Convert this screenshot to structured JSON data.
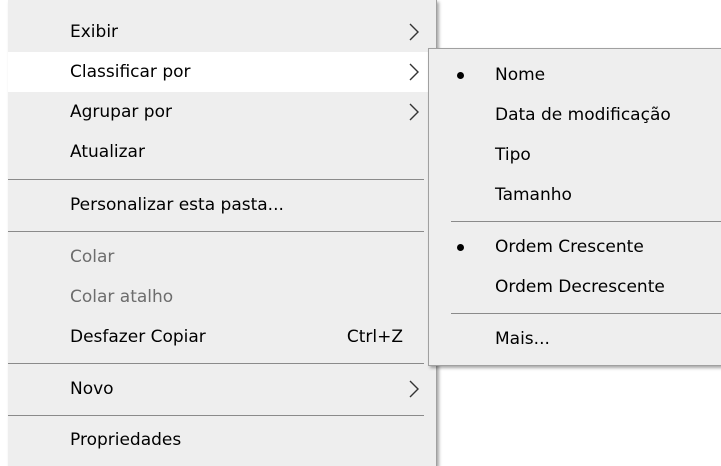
{
  "context_menu": {
    "items": [
      {
        "label": "Exibir",
        "submenu": true
      },
      {
        "label": "Classificar por",
        "submenu": true
      },
      {
        "label": "Agrupar por",
        "submenu": true
      },
      {
        "label": "Atualizar"
      },
      {
        "label": "Personalizar esta pasta..."
      },
      {
        "label": "Colar",
        "disabled": true
      },
      {
        "label": "Colar atalho",
        "disabled": true
      },
      {
        "label": "Desfazer Copiar",
        "shortcut": "Ctrl+Z"
      },
      {
        "label": "Novo",
        "submenu": true
      },
      {
        "label": "Propriedades"
      }
    ]
  },
  "sort_submenu": {
    "items": [
      {
        "label": "Nome",
        "selected": true
      },
      {
        "label": "Data de modificação"
      },
      {
        "label": "Tipo"
      },
      {
        "label": "Tamanho"
      },
      {
        "label": "Ordem Crescente",
        "selected": true
      },
      {
        "label": "Ordem Decrescente"
      },
      {
        "label": "Mais..."
      }
    ]
  },
  "colors": {
    "menu_background": "#eeeeee",
    "highlight": "#ffffff",
    "disabled_text": "#6d6d6d",
    "separator": "#8a8a8a"
  }
}
